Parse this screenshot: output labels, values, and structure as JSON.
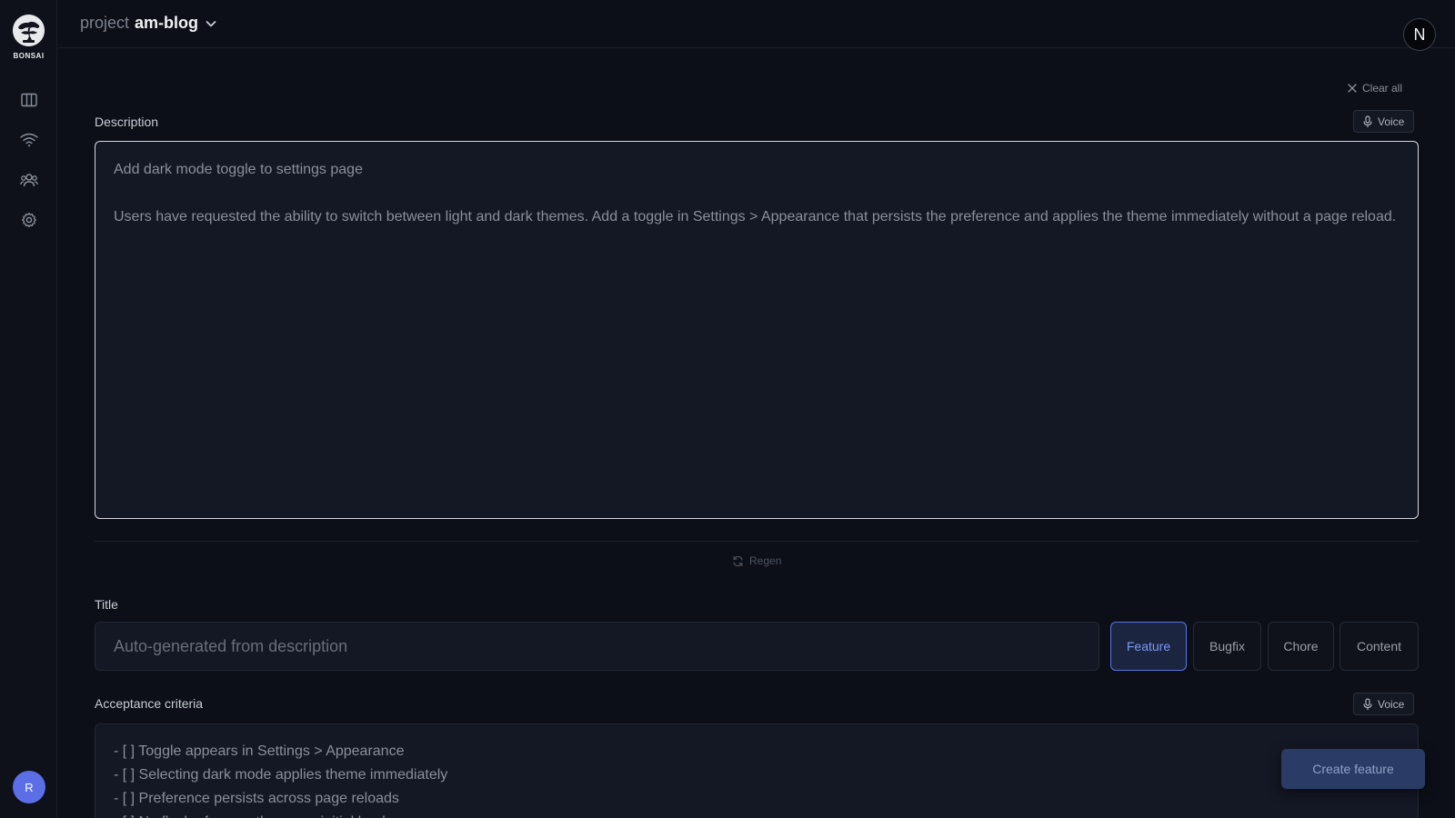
{
  "app": {
    "logo_text": "BONSAI"
  },
  "sidebar": {
    "items": [
      {
        "name": "board",
        "icon": "columns-icon"
      },
      {
        "name": "wireless",
        "icon": "wifi-icon"
      },
      {
        "name": "team",
        "icon": "users-icon"
      },
      {
        "name": "settings",
        "icon": "gear-icon"
      }
    ],
    "user_initial": "R"
  },
  "header": {
    "project_label": "project",
    "project_name": "am-blog",
    "avatar_letter": "N"
  },
  "main": {
    "clear_all": "Clear all",
    "description_label": "Description",
    "description_voice": "Voice",
    "description_text": "Add dark mode toggle to settings page\n\nUsers have requested the ability to switch between light and dark themes. Add a toggle in Settings > Appearance that persists the preference and applies the theme immediately without a page reload.",
    "regen": "Regen",
    "title_label": "Title",
    "title_placeholder": "Auto-generated from description",
    "types": [
      {
        "label": "Feature",
        "active": true
      },
      {
        "label": "Bugfix",
        "active": false
      },
      {
        "label": "Chore",
        "active": false
      },
      {
        "label": "Content",
        "active": false
      }
    ],
    "criteria_label": "Acceptance criteria",
    "criteria_voice": "Voice",
    "criteria_lines": [
      "- [ ] Toggle appears in Settings > Appearance",
      "- [ ] Selecting dark mode applies theme immediately",
      "- [ ] Preference persists across page reloads",
      "- [ ] No flash of wrong theme on initial load"
    ],
    "create_button": "Create feature"
  },
  "colors": {
    "background": "#0c0f17",
    "accent": "#5a76e0",
    "avatar": "#5b6ee6"
  }
}
